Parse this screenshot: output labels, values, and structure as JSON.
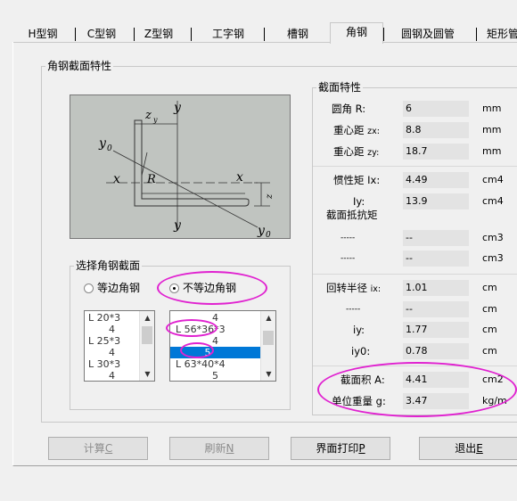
{
  "tabs": [
    "H型钢",
    "C型钢",
    "Z型钢",
    "工字钢",
    "槽钢",
    "角钢",
    "圆钢及圆管",
    "矩形管"
  ],
  "active_tab": "角钢",
  "section_group": {
    "title": "角钢截面特性",
    "diagram": {
      "labels": [
        "z",
        "y",
        "y",
        "y",
        "x",
        "x",
        "R",
        "y",
        "z",
        "y"
      ],
      "subs": [
        "y",
        "0",
        "x",
        "0"
      ]
    }
  },
  "select_group": {
    "title": "选择角钢截面",
    "radio_equal": "等边角钢",
    "radio_unequal": "不等边角钢",
    "selected_radio": "unequal",
    "left_list": [
      "L 20*3",
      "4",
      "L 25*3",
      "4",
      "L 30*3",
      "4"
    ],
    "right_list": [
      "4",
      "L 56*36*3",
      "4",
      "5",
      "L 63*40*4",
      "5"
    ],
    "right_selected": "5"
  },
  "props": {
    "title": "截面特性",
    "subtitle_modulus": "截面抵抗矩",
    "rows": [
      {
        "label": "圆角   R:",
        "value": "6",
        "unit": "mm"
      },
      {
        "label": "重心距",
        "sub": "zx:",
        "value": "8.8",
        "unit": "mm"
      },
      {
        "label": "重心距",
        "sub": "zy:",
        "value": "18.7",
        "unit": "mm"
      },
      {
        "label": "惯性矩 Ix:",
        "value": "4.49",
        "unit": "cm4"
      },
      {
        "label": "Iy:",
        "value": "13.9",
        "unit": "cm4"
      },
      {
        "label": "-----",
        "value": "--",
        "unit": "cm3"
      },
      {
        "label": "-----",
        "value": "--",
        "unit": "cm3"
      },
      {
        "label": "回转半径",
        "sub": "ix:",
        "value": "1.01",
        "unit": "cm"
      },
      {
        "label": "-----",
        "value": "--",
        "unit": "cm"
      },
      {
        "label": "iy:",
        "value": "1.77",
        "unit": "cm"
      },
      {
        "label": "iy0:",
        "value": "0.78",
        "unit": "cm"
      },
      {
        "label": "截面积 A:",
        "value": "4.41",
        "unit": "cm2"
      },
      {
        "label": "单位重量 g:",
        "value": "3.47",
        "unit": "kg/m"
      }
    ]
  },
  "buttons": {
    "calc": "计算",
    "calc_key": "C",
    "refresh": "刷新",
    "refresh_key": "N",
    "print": "界面打印",
    "print_key": "P",
    "exit": "退出",
    "exit_key": "E"
  },
  "colors": {
    "accent": "#0078d7",
    "highlight": "#e022d0",
    "diagram_bg": "#c0c4c0"
  }
}
